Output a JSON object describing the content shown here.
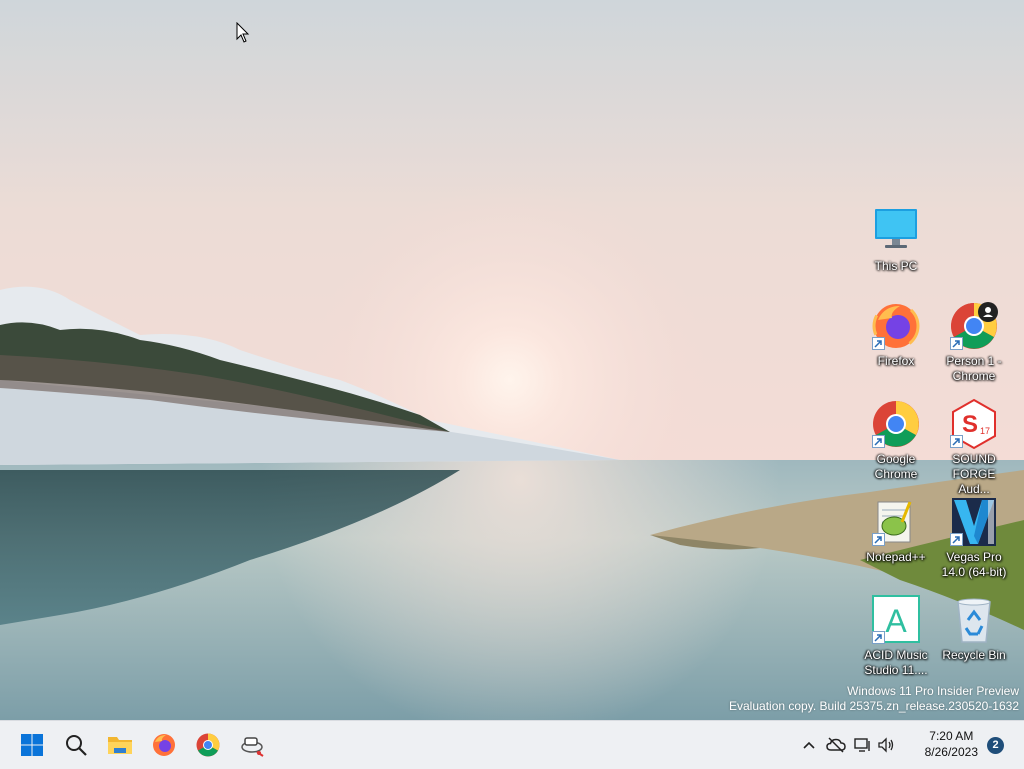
{
  "desktop": {
    "icons": [
      {
        "label": "This PC"
      },
      {
        "label": "Firefox"
      },
      {
        "label": "Person 1 - Chrome"
      },
      {
        "label": "Google Chrome"
      },
      {
        "label": "SOUND FORGE Aud..."
      },
      {
        "label": "Notepad++"
      },
      {
        "label": "Vegas Pro 14.0 (64-bit)"
      },
      {
        "label": "ACID Music Studio 11...."
      },
      {
        "label": "Recycle Bin"
      }
    ],
    "sound_forge_version": "17",
    "acid_letter": "A",
    "watermark": {
      "line1": "Windows 11 Pro Insider Preview",
      "line2": "Evaluation copy. Build 25375.zn_release.230520-1632"
    }
  },
  "taskbar": {
    "apps": [
      "start-icon",
      "search-icon",
      "file-explorer-icon",
      "firefox-icon",
      "chrome-icon",
      "network-cable-app-icon"
    ],
    "tray_icons": [
      "chevron-up-icon",
      "onedrive-offline-icon",
      "network-icon",
      "volume-icon"
    ],
    "clock": {
      "time": "7:20 AM",
      "date": "8/26/2023"
    },
    "notification_count": "2"
  }
}
